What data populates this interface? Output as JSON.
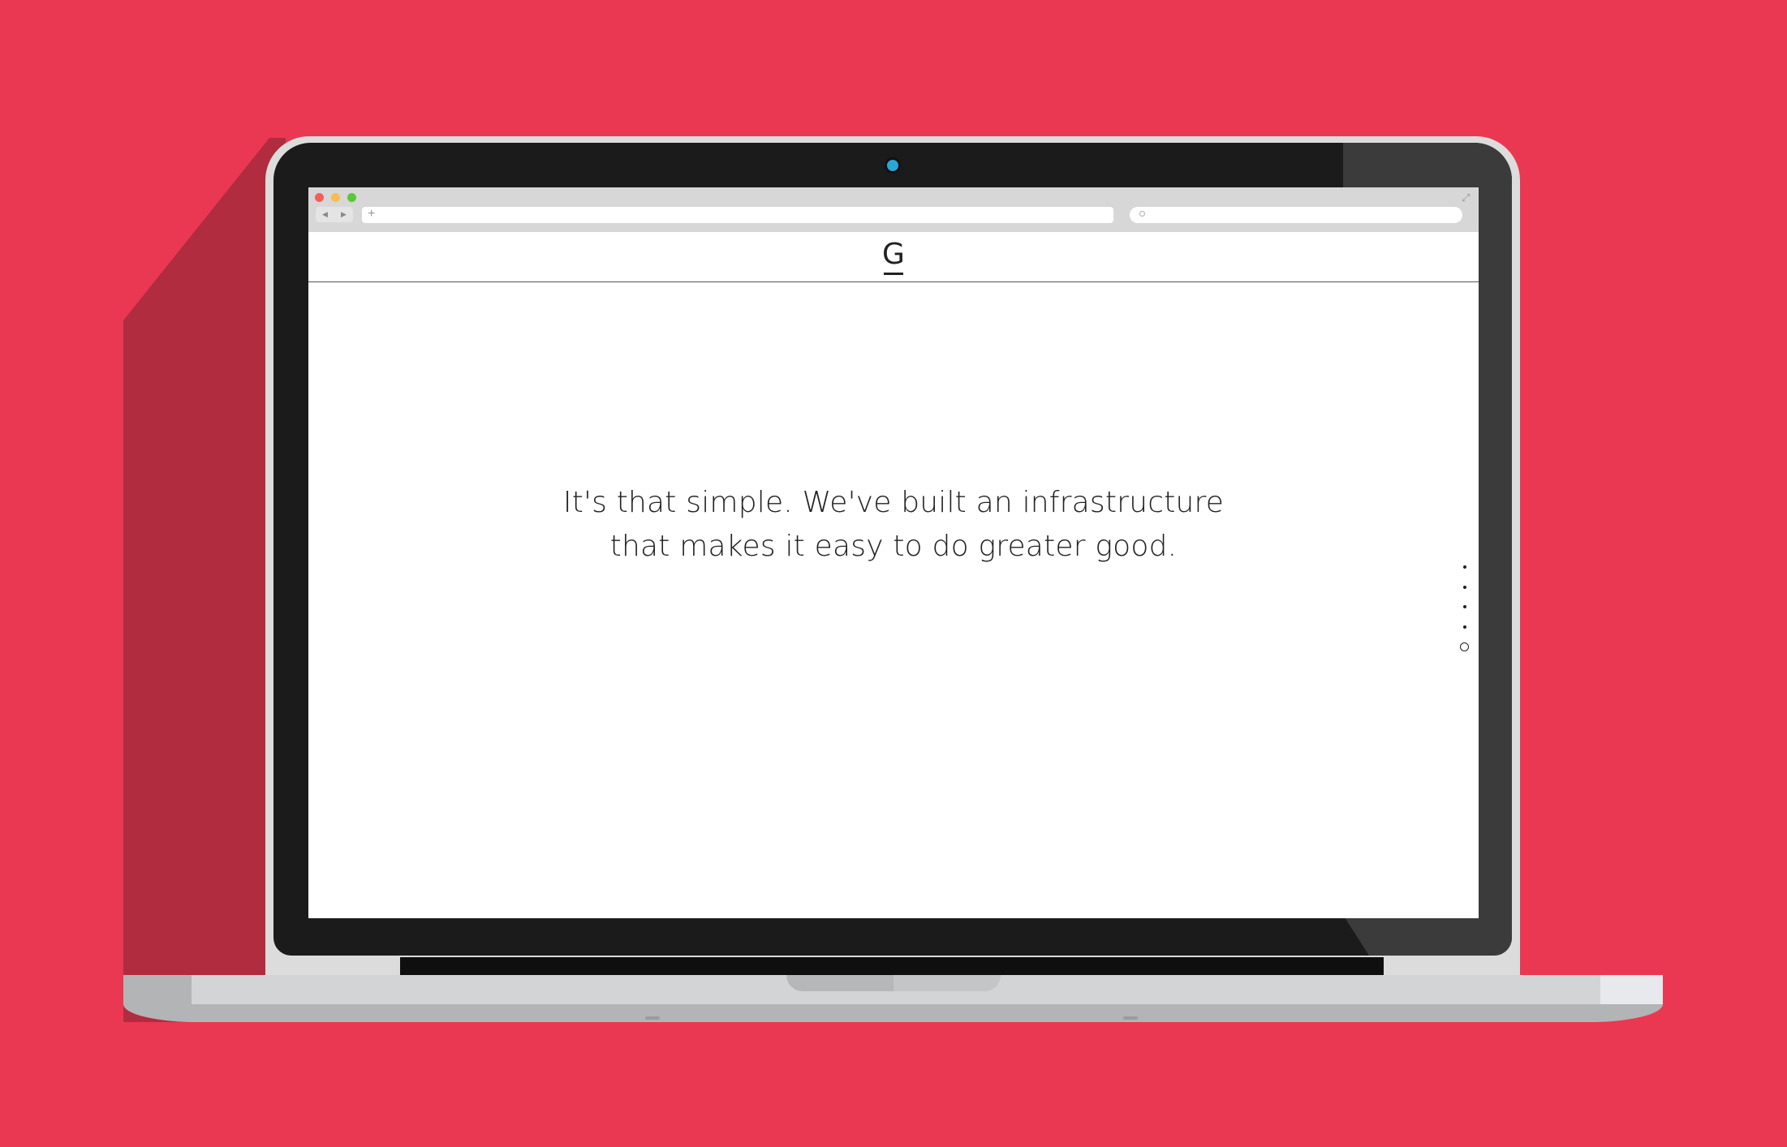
{
  "colors": {
    "background": "#ea3852",
    "shadow": "#b02c3e",
    "lid_rim": "#dcdcdc",
    "bezel": "#1b1b1b",
    "bezel_glare": "#3b3b3b",
    "camera": "#2aa6d6",
    "chrome_bg": "#d7d7d7",
    "chrome_bar": "#ffffff",
    "close_dot": "#f25f58",
    "minimize_dot": "#f5be4f",
    "zoom_dot": "#59c837",
    "page_bg": "#ffffff",
    "text": "#222222",
    "header_border": "#555555",
    "base": "#d3d4d6",
    "base_dark": "#b3b4b6",
    "base_light": "#e7e9ec",
    "hinge": "#0f0f0f",
    "notch": "#b6b7b9"
  },
  "browser": {
    "window_controls": [
      "close",
      "minimize",
      "zoom"
    ],
    "back_icon": "◀",
    "forward_icon": "▶",
    "new_tab_icon": "+",
    "address_value": "",
    "search_value": "",
    "search_icon": "magnifier-icon",
    "fullscreen_icon": "⤢"
  },
  "site": {
    "logo_letter": "G",
    "headline_line1": "It's that simple. We've built an infrastructure",
    "headline_line2": "that makes it easy to do greater good.",
    "pager": {
      "total_pages": 5,
      "current_page": 5
    }
  }
}
